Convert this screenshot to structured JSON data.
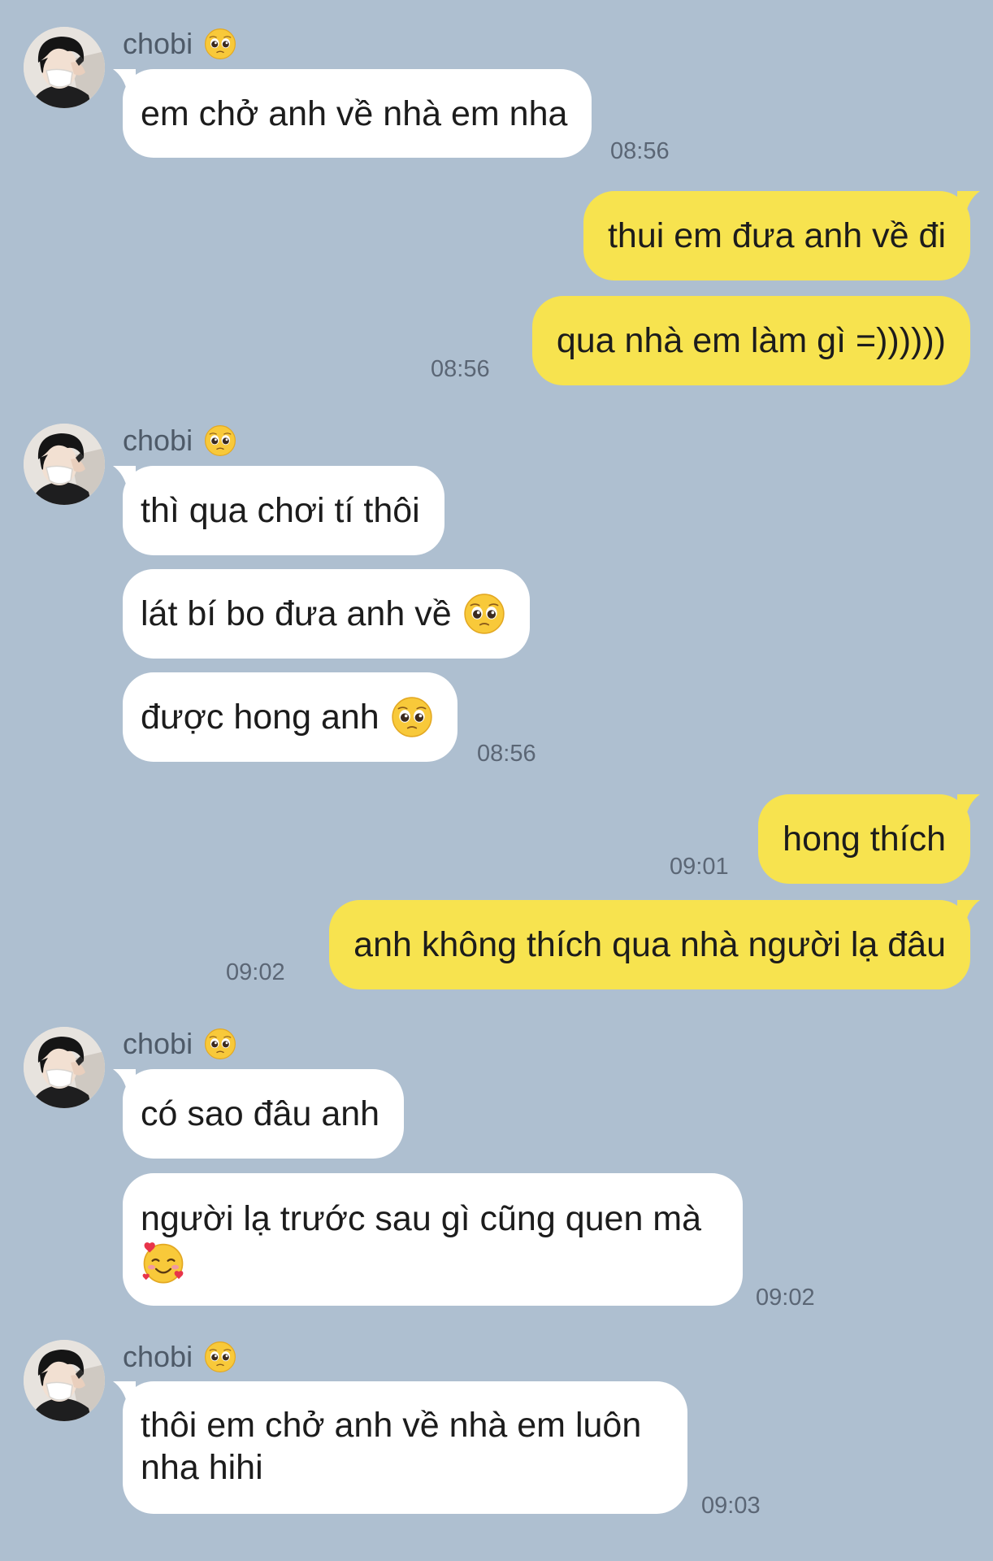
{
  "contact": {
    "name": "chobi",
    "name_emoji": "pleading-face"
  },
  "messages": [
    {
      "id": 1,
      "side": "in",
      "text": "em chở anh về nhà em nha",
      "time": "08:56"
    },
    {
      "id": 2,
      "side": "out",
      "text": "thui em đưa anh về đi"
    },
    {
      "id": 3,
      "side": "out",
      "text": "qua nhà em làm gì =))))))",
      "time": "08:56"
    },
    {
      "id": 4,
      "side": "in",
      "text": "thì qua chơi tí thôi"
    },
    {
      "id": 5,
      "side": "in",
      "text": "lát bí bo đưa anh về",
      "emoji": "pleading-face"
    },
    {
      "id": 6,
      "side": "in",
      "text": "được hong anh",
      "emoji": "pleading-face",
      "time": "08:56"
    },
    {
      "id": 7,
      "side": "out",
      "text": "hong thích",
      "time": "09:01"
    },
    {
      "id": 8,
      "side": "out",
      "text": "anh không thích qua nhà người lạ đâu",
      "time": "09:02"
    },
    {
      "id": 9,
      "side": "in",
      "text": "có sao đâu anh"
    },
    {
      "id": 10,
      "side": "in",
      "text": "người lạ trước sau gì cũng quen mà",
      "emoji": "smiling-face-with-hearts",
      "time": "09:02"
    },
    {
      "id": 11,
      "side": "in",
      "text": "thôi em chở anh về nhà em luôn nha hihi",
      "time": "09:03"
    }
  ],
  "colors": {
    "background": "#aebfd0",
    "incoming_bubble": "#ffffff",
    "outgoing_bubble": "#f7e34f",
    "time_text": "#5b6675",
    "name_text": "#4e5a68"
  }
}
